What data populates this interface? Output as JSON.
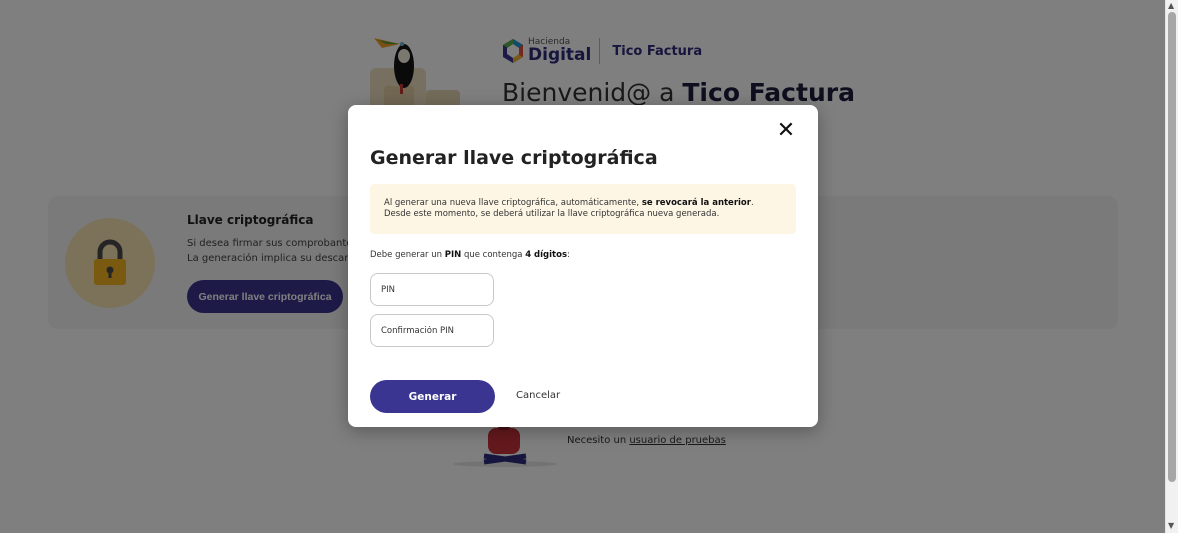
{
  "brand": {
    "logo_small": "Hacienda",
    "logo_big": "Digital",
    "app_name": "Tico Factura",
    "primary_color": "#3a3590"
  },
  "welcome": {
    "prefix": "Bienvenid@ a ",
    "app": "Tico Factura"
  },
  "card": {
    "title": "Llave criptográfica",
    "line1": "Si desea firmar sus comprobante el",
    "line2": "La generación implica su descarga",
    "button": "Generar llave criptográfica",
    "icon": "lock-icon"
  },
  "test_user": {
    "prefix": "Necesito un ",
    "link": "usuario de pruebas"
  },
  "modal": {
    "title": "Generar llave criptográfica",
    "notice": {
      "part1": "Al generar una nueva llave criptográfica, automáticamente, ",
      "bold": "se revocará la anterior",
      "part2": ".",
      "line2": "Desde este momento, se deberá utilizar la llave criptográfica nueva generada."
    },
    "instruction": {
      "part1": "Debe generar un ",
      "bold1": "PIN",
      "part2": " que contenga ",
      "bold2": "4 dígitos",
      "part3": ":"
    },
    "pin_placeholder": "PIN",
    "pin_confirm_placeholder": "Confirmación PIN",
    "generate_button": "Generar",
    "cancel_button": "Cancelar",
    "close_icon": "close-icon"
  }
}
